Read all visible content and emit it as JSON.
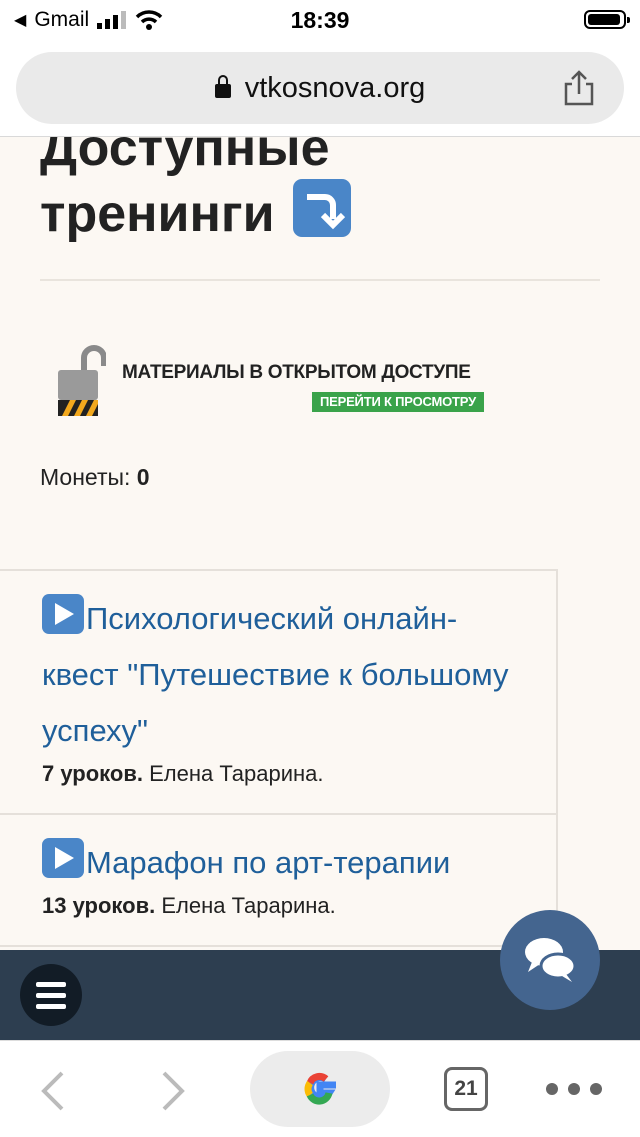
{
  "status_bar": {
    "back_app": "Gmail",
    "time": "18:39"
  },
  "browser": {
    "url": "vtkosnova.org",
    "tabs_count": "21"
  },
  "page": {
    "title_line1": "Доступные",
    "title_line2": "тренинги",
    "banner": {
      "title": "МАТЕРИАЛЫ В ОТКРЫТОМ ДОСТУПЕ",
      "button": "ПЕРЕЙТИ К ПРОСМОТРУ"
    },
    "coins": {
      "label": "Монеты:",
      "value": "0"
    },
    "trainings": [
      {
        "title": "Психологический онлайн-квест \"Путешествие к большому успеху\"",
        "lessons": "7 уроков.",
        "author": "Елена Тарарина."
      },
      {
        "title": "Марафон по арт-терапии",
        "lessons": "13 уроков.",
        "author": "Елена Тарарина."
      }
    ]
  },
  "colors": {
    "accent_blue": "#1f5f9a",
    "green_button": "#3aa34a",
    "dark_bar": "#2d3e50",
    "chat_button": "#44658f",
    "page_bg": "#fcf8f3"
  },
  "icons": [
    "signal-icon",
    "wifi-icon",
    "battery-icon",
    "lock-icon",
    "share-icon",
    "arrow-down-right-icon",
    "padlock-icon",
    "play-icon",
    "menu-icon",
    "chat-icon",
    "back-arrow-icon",
    "forward-arrow-icon",
    "google-icon",
    "tabs-icon",
    "more-icon"
  ]
}
